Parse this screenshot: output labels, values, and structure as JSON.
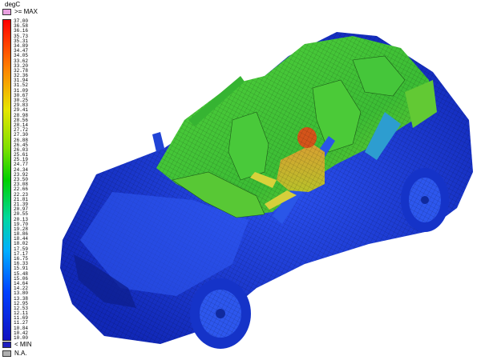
{
  "legend": {
    "unit": "degC",
    "max_label": ">= MAX",
    "min_label": "< MIN",
    "na_label": "N.A.",
    "max_color": "#e8a0e0",
    "min_color": "#2020c0",
    "na_color": "#b0b0b0",
    "ticks": [
      "37.00",
      "36.58",
      "36.16",
      "35.73",
      "35.31",
      "34.89",
      "34.47",
      "34.05",
      "33.62",
      "33.20",
      "32.78",
      "32.36",
      "31.94",
      "31.52",
      "31.09",
      "30.67",
      "30.25",
      "29.83",
      "29.41",
      "28.98",
      "28.56",
      "28.14",
      "27.72",
      "27.30",
      "26.88",
      "26.45",
      "26.03",
      "25.61",
      "25.19",
      "24.77",
      "24.34",
      "23.92",
      "23.50",
      "23.08",
      "22.66",
      "22.23",
      "21.81",
      "21.39",
      "20.97",
      "20.55",
      "20.13",
      "19.70",
      "19.28",
      "18.86",
      "18.44",
      "18.02",
      "17.59",
      "17.17",
      "16.75",
      "16.33",
      "15.91",
      "15.48",
      "15.06",
      "14.64",
      "14.22",
      "13.80",
      "13.38",
      "12.95",
      "12.53",
      "12.11",
      "11.69",
      "11.27",
      "10.84",
      "10.42",
      "10.00"
    ]
  },
  "scene": {
    "subject": "car thermal simulation with occupant",
    "body_color": "#1a3fd8",
    "cabin_color": "#3fc23a",
    "occupant_color": "#c9a22a",
    "head_color": "#d4541a"
  }
}
